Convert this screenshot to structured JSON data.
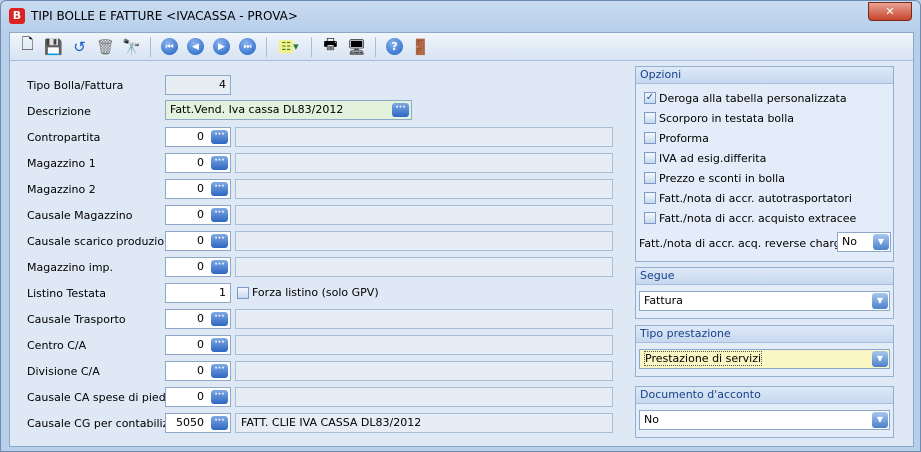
{
  "window": {
    "title": "TIPI BOLLE E FATTURE <IVACASSA - PROVA>",
    "close": "✕",
    "app_icon": "B"
  },
  "toolbar": [
    "new",
    "save",
    "undo",
    "delete",
    "find",
    "first",
    "prev",
    "next",
    "last",
    "options",
    "print",
    "preview",
    "help",
    "exit"
  ],
  "form": {
    "tipo": {
      "label": "Tipo Bolla/Fattura",
      "value": "4"
    },
    "descrizione": {
      "label": "Descrizione",
      "value": "Fatt.Vend. Iva cassa DL83/2012"
    },
    "rows": [
      {
        "label": "Contropartita",
        "value": "0",
        "desc": ""
      },
      {
        "label": "Magazzino 1",
        "value": "0",
        "desc": ""
      },
      {
        "label": "Magazzino 2",
        "value": "0",
        "desc": ""
      },
      {
        "label": "Causale Magazzino",
        "value": "0",
        "desc": ""
      },
      {
        "label": "Causale scarico produzione",
        "value": "0",
        "desc": ""
      },
      {
        "label": "Magazzino imp.",
        "value": "0",
        "desc": ""
      }
    ],
    "listino": {
      "label": "Listino Testata",
      "value": "1",
      "check": "Forza listino (solo GPV)"
    },
    "rows2": [
      {
        "label": "Causale Trasporto",
        "value": "0",
        "desc": ""
      },
      {
        "label": "Centro C/A",
        "value": "0",
        "desc": ""
      },
      {
        "label": "Divisione C/A",
        "value": "0",
        "desc": ""
      },
      {
        "label": "Causale CA spese di piede",
        "value": "0",
        "desc": ""
      },
      {
        "label": "Causale CG per contabilizz.",
        "value": "5050",
        "desc": "FATT. CLIE IVA CASSA DL83/2012"
      }
    ]
  },
  "opzioni": {
    "title": "Opzioni",
    "items": [
      {
        "label": "Deroga alla tabella personalizzata",
        "checked": true
      },
      {
        "label": "Scorporo in testata bolla",
        "checked": false
      },
      {
        "label": "Proforma",
        "checked": false
      },
      {
        "label": "IVA ad esig.differita",
        "checked": false
      },
      {
        "label": "Prezzo e sconti in bolla",
        "checked": false
      },
      {
        "label": "Fatt./nota di accr. autotrasportatori",
        "checked": false
      },
      {
        "label": "Fatt./nota di accr. acquisto extracee",
        "checked": false
      }
    ],
    "reverse_label": "Fatt./nota di accr. acq. reverse charge",
    "reverse_value": "No"
  },
  "segue": {
    "title": "Segue",
    "value": "Fattura"
  },
  "prestazione": {
    "title": "Tipo prestazione",
    "value": "Prestazione di servizi"
  },
  "acconto": {
    "title": "Documento d'acconto",
    "value": "No"
  }
}
